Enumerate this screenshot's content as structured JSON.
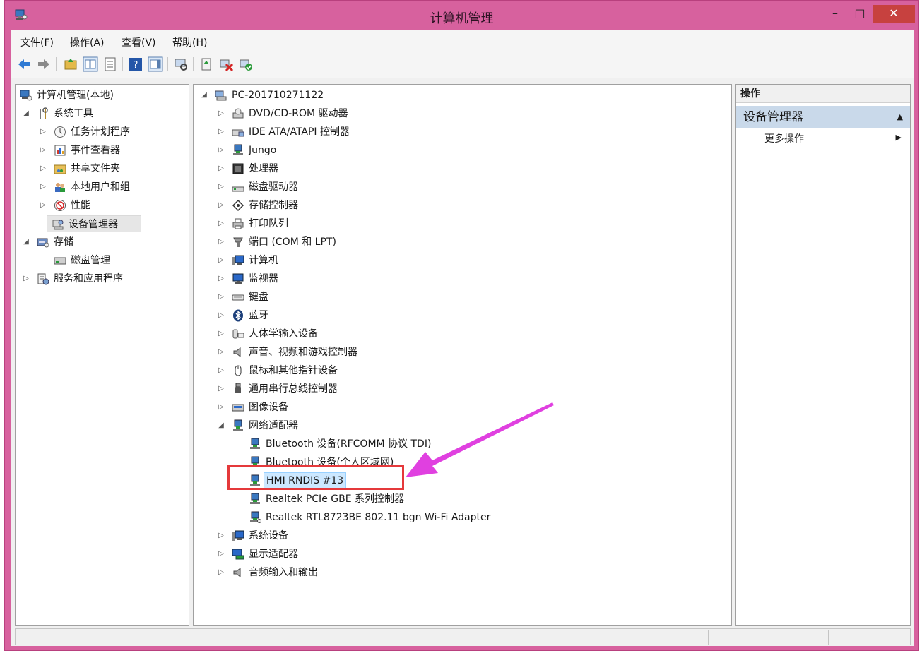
{
  "window": {
    "title": "计算机管理",
    "min_glyph": "–",
    "max_glyph": "□",
    "close_glyph": "✕"
  },
  "menu": [
    "文件(F)",
    "操作(A)",
    "查看(V)",
    "帮助(H)"
  ],
  "left_tree": [
    {
      "label": "计算机管理(本地)",
      "icon": "computer-management-icon"
    },
    {
      "label": "系统工具",
      "icon": "tools-icon"
    },
    {
      "label": "任务计划程序",
      "icon": "clock-icon"
    },
    {
      "label": "事件查看器",
      "icon": "event-viewer-icon"
    },
    {
      "label": "共享文件夹",
      "icon": "shared-folder-icon"
    },
    {
      "label": "本地用户和组",
      "icon": "users-icon"
    },
    {
      "label": "性能",
      "icon": "performance-icon"
    },
    {
      "label": "设备管理器",
      "icon": "device-manager-icon"
    },
    {
      "label": "存储",
      "icon": "storage-icon"
    },
    {
      "label": "磁盘管理",
      "icon": "disk-icon"
    },
    {
      "label": "服务和应用程序",
      "icon": "services-icon"
    }
  ],
  "device_tree": {
    "root": "PC-201710271122",
    "categories": [
      "DVD/CD-ROM 驱动器",
      "IDE ATA/ATAPI 控制器",
      "Jungo",
      "处理器",
      "磁盘驱动器",
      "存储控制器",
      "打印队列",
      "端口 (COM 和 LPT)",
      "计算机",
      "监视器",
      "键盘",
      "蓝牙",
      "人体学输入设备",
      "声音、视频和游戏控制器",
      "鼠标和其他指针设备",
      "通用串行总线控制器",
      "图像设备",
      "网络适配器"
    ],
    "network_children": [
      "Bluetooth 设备(RFCOMM 协议 TDI)",
      "Bluetooth 设备(个人区域网)",
      "HMI RNDIS #13",
      "Realtek PCIe GBE 系列控制器",
      "Realtek RTL8723BE 802.11 bgn Wi-Fi Adapter"
    ],
    "trailing": [
      "系统设备",
      "显示适配器",
      "音频输入和输出"
    ]
  },
  "actions": {
    "header": "操作",
    "section": "设备管理器",
    "more": "更多操作"
  },
  "colors": {
    "title_bar": "#d7619e",
    "close_button": "#c7413f",
    "highlight_box": "#e5393b",
    "arrow": "#e040e0",
    "ops_section_bg": "#c9d9ea"
  }
}
